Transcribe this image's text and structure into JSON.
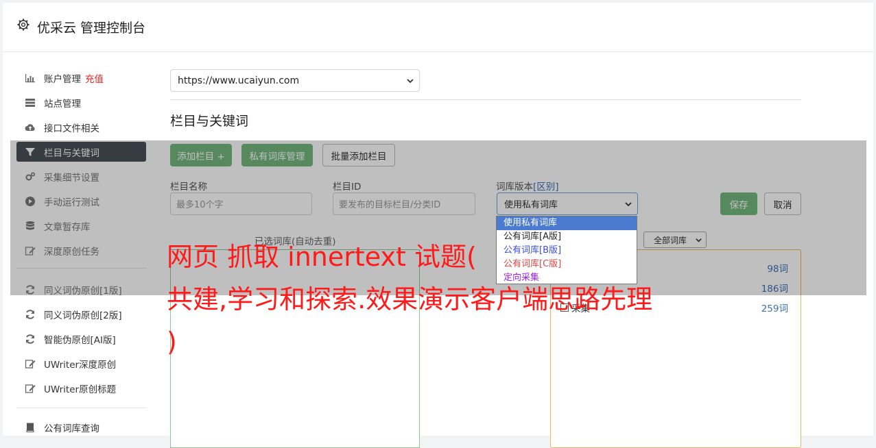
{
  "header": {
    "title": "优采云 管理控制台"
  },
  "sidebar": {
    "items": [
      {
        "label": "账户管理",
        "badge": "充值",
        "icon": "bar-chart-icon"
      },
      {
        "label": "站点管理",
        "icon": "server-icon"
      },
      {
        "label": "接口文件相关",
        "icon": "cloud-upload-icon"
      },
      {
        "label": "栏目与关键词",
        "icon": "filter-icon",
        "active": true
      },
      {
        "label": "采集细节设置",
        "icon": "cogs-icon"
      },
      {
        "label": "手动运行测试",
        "icon": "play-circle-icon"
      },
      {
        "label": "文章暂存库",
        "icon": "database-icon"
      },
      {
        "label": "深度原创任务",
        "icon": "edit-icon"
      },
      {
        "label": "同义词伪原创[1版]",
        "icon": "refresh-icon"
      },
      {
        "label": "同义词伪原创[2版]",
        "icon": "refresh-icon"
      },
      {
        "label": "智能伪原创[AI版]",
        "icon": "refresh-icon"
      },
      {
        "label": "UWriter深度原创",
        "icon": "edit-icon"
      },
      {
        "label": "UWriter原创标题",
        "icon": "edit-icon"
      },
      {
        "label": "公有词库查询",
        "icon": "book-icon"
      }
    ]
  },
  "site_select": {
    "value": "https://www.ucaiyun.com"
  },
  "section": {
    "title": "栏目与关键词"
  },
  "toolbar": {
    "add_column": "添加栏目 +",
    "private_lib": "私有词库管理",
    "batch_add": "批量添加栏目"
  },
  "form": {
    "name_label": "栏目名称",
    "name_placeholder": "最多10个字",
    "id_label": "栏目ID",
    "id_placeholder": "要发布的目标栏目/分类ID",
    "version_label": "词库版本",
    "version_link": "[区别]",
    "version_value": "使用私有词库",
    "save": "保存",
    "cancel": "取消"
  },
  "dropdown": {
    "options": [
      "使用私有词库",
      "公有词库[A版]",
      "公有词库[B版]",
      "公有词库[C版]",
      "定向采集"
    ]
  },
  "lib": {
    "selected_head": "已选词库(自动去重)",
    "filter_value": "全部词库",
    "rows": [
      {
        "name": "",
        "count": "98词"
      },
      {
        "name": "",
        "count": "186词"
      },
      {
        "name": "采集",
        "count": "259词"
      }
    ]
  },
  "watermark": {
    "line1": "网页 抓取 innertext 试题(",
    "line2": "共建,学习和探索.效果演示客户端思路先理",
    "line3": ")"
  },
  "colors": {
    "accent_green": "#74b77e",
    "active_menu": "#495057",
    "link_blue": "#3b6fb6",
    "watermark_red": "#ff1a1a"
  }
}
